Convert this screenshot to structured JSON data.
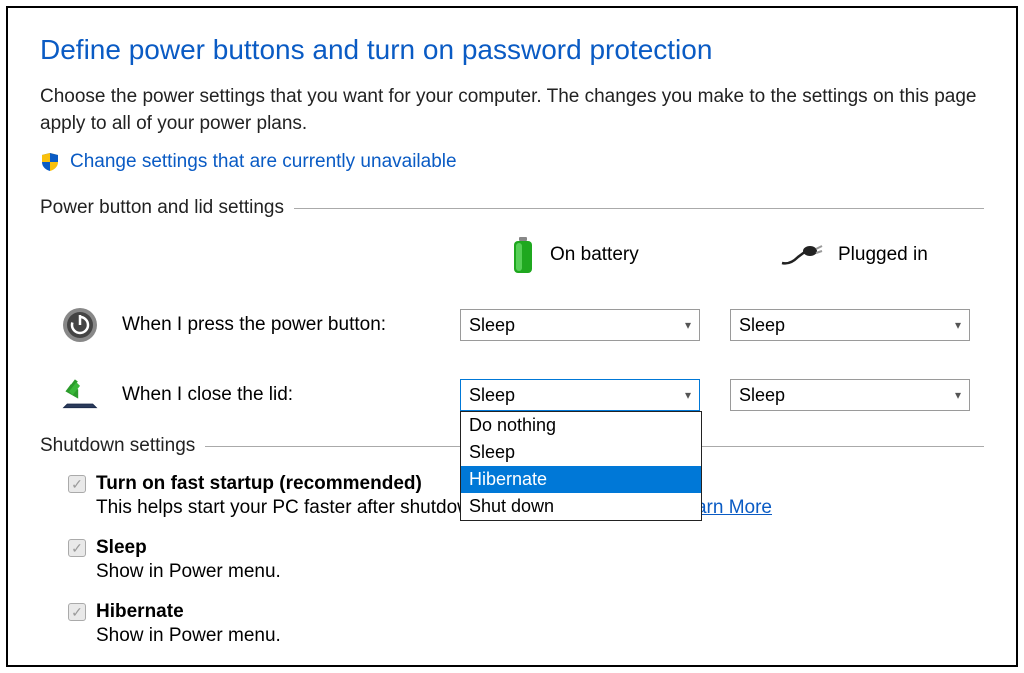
{
  "heading": "Define power buttons and turn on password protection",
  "subtext": "Choose the power settings that you want for your computer. The changes you make to the settings on this page apply to all of your power plans.",
  "change_link": "Change settings that are currently unavailable",
  "sections": {
    "buttons_lid": "Power button and lid settings",
    "shutdown": "Shutdown settings"
  },
  "columns": {
    "battery": "On battery",
    "plugged": "Plugged in"
  },
  "rows": {
    "power": {
      "label": "When I press the power button:",
      "battery": "Sleep",
      "plugged": "Sleep"
    },
    "lid": {
      "label": "When I close the lid:",
      "battery": "Sleep",
      "plugged": "Sleep"
    }
  },
  "dropdown_open": {
    "options": [
      "Do nothing",
      "Sleep",
      "Hibernate",
      "Shut down"
    ],
    "highlighted": "Hibernate"
  },
  "shutdown_items": {
    "fast": {
      "title": "Turn on fast startup (recommended)",
      "desc_pre": "This helps start your PC faster after shutdown. Restart isn't affected. ",
      "learn": "Learn More"
    },
    "sleep": {
      "title": "Sleep",
      "desc": "Show in Power menu."
    },
    "hibernate": {
      "title": "Hibernate",
      "desc": "Show in Power menu."
    }
  }
}
